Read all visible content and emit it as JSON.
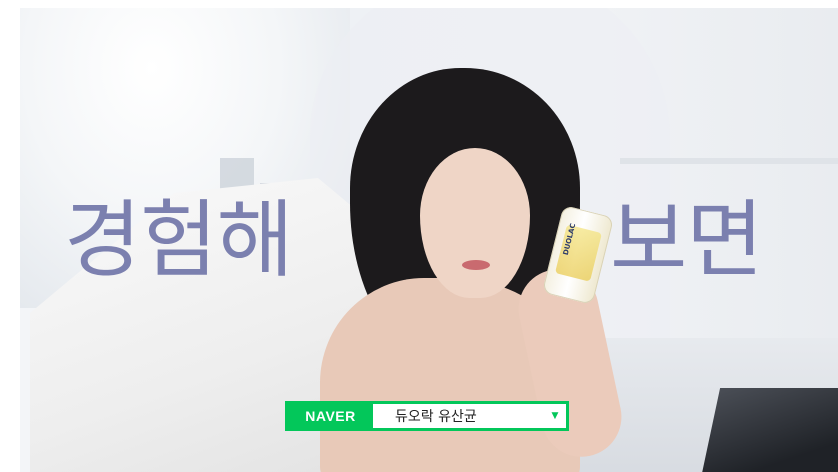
{
  "headline": {
    "left": "경험해",
    "right": "보면",
    "color": "#6f74a8"
  },
  "product": {
    "bottle_label": "DUOLAC"
  },
  "search_bar": {
    "logo": "NAVER",
    "query": "듀오락 유산균",
    "dropdown_icon": "triangle-down-icon",
    "accent_color": "#03c75a"
  }
}
